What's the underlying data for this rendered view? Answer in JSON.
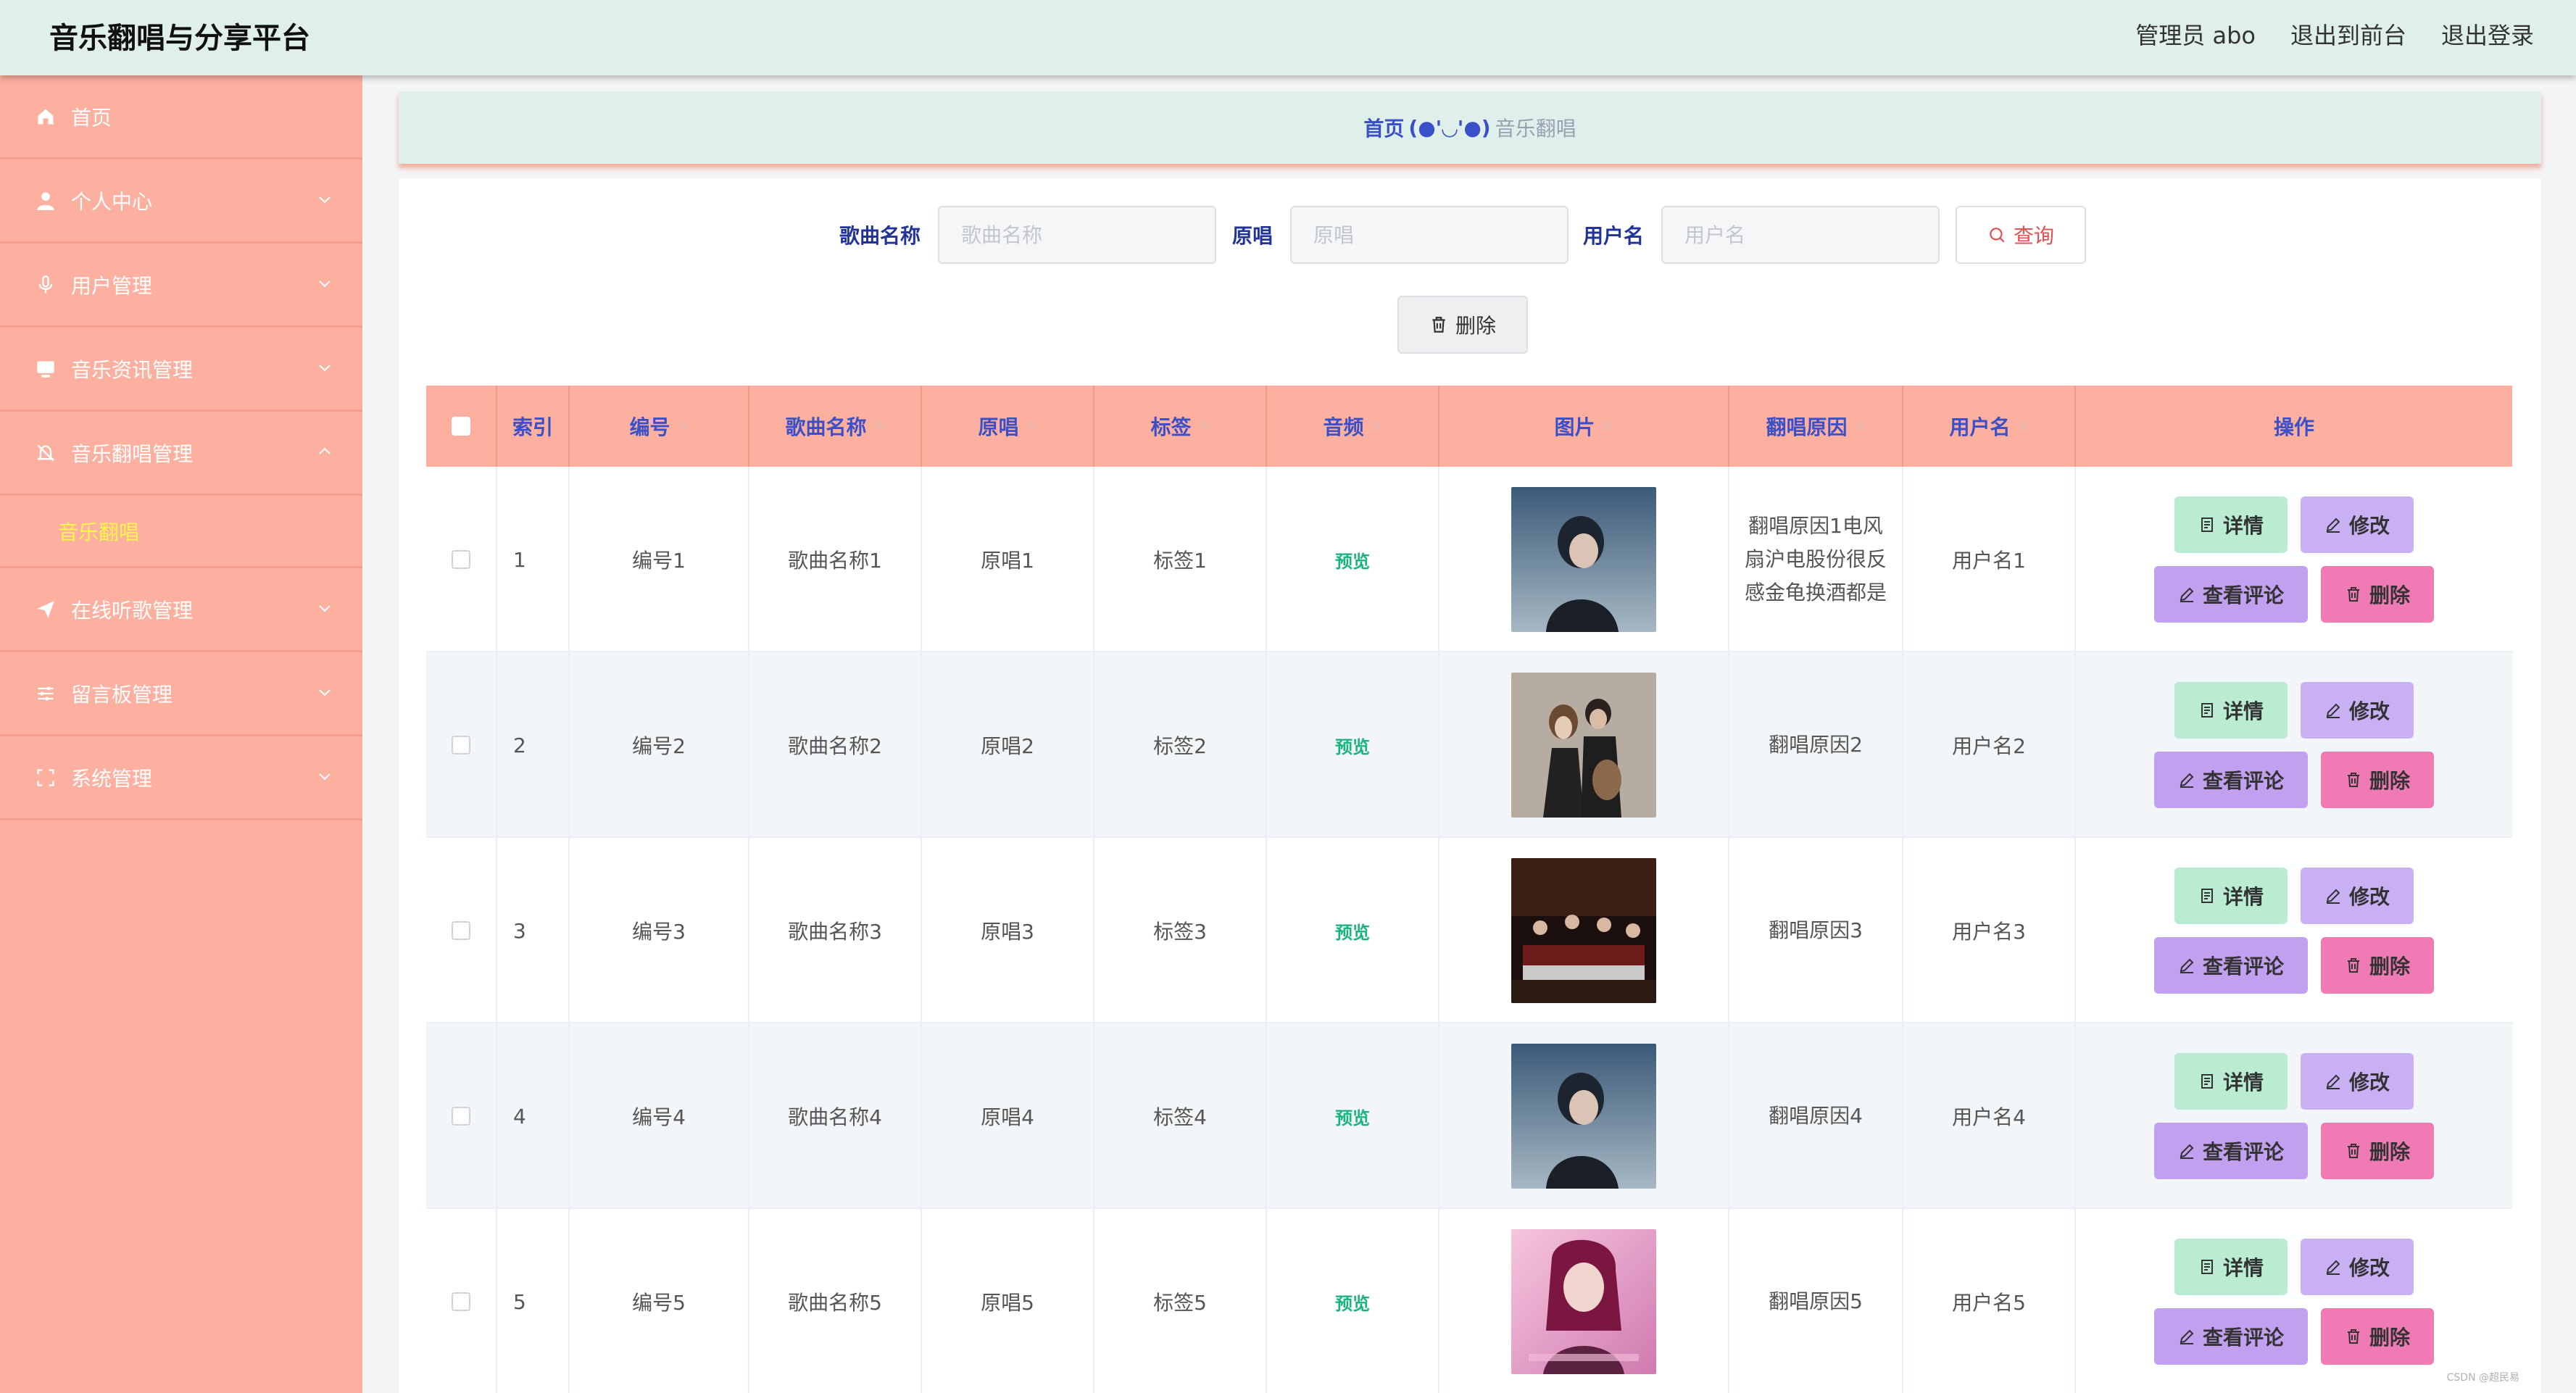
{
  "app": {
    "title": "音乐翻唱与分享平台",
    "top_links": [
      "管理员 abo",
      "退出到前台",
      "退出登录"
    ]
  },
  "sidebar": {
    "items": [
      {
        "label": "首页",
        "icon": "home-icon",
        "expandable": false
      },
      {
        "label": "个人中心",
        "icon": "user-icon",
        "expandable": true
      },
      {
        "label": "用户管理",
        "icon": "microphone-icon",
        "expandable": true
      },
      {
        "label": "音乐资讯管理",
        "icon": "monitor-icon",
        "expandable": true
      },
      {
        "label": "音乐翻唱管理",
        "icon": "bell-off-icon",
        "expandable": true,
        "expanded": true,
        "children": [
          "音乐翻唱"
        ]
      },
      {
        "label": "在线听歌管理",
        "icon": "send-icon",
        "expandable": true
      },
      {
        "label": "留言板管理",
        "icon": "sliders-icon",
        "expandable": true
      },
      {
        "label": "系统管理",
        "icon": "fullscreen-icon",
        "expandable": true
      }
    ]
  },
  "breadcrumb": {
    "home": "首页",
    "separator": "(●'◡'●)",
    "current": "音乐翻唱"
  },
  "search": {
    "fields": [
      {
        "label": "歌曲名称",
        "placeholder": "歌曲名称",
        "value": ""
      },
      {
        "label": "原唱",
        "placeholder": "原唱",
        "value": ""
      },
      {
        "label": "用户名",
        "placeholder": "用户名",
        "value": ""
      }
    ],
    "query_button": "查询",
    "delete_button": "删除"
  },
  "table": {
    "columns": [
      "索引",
      "编号",
      "歌曲名称",
      "原唱",
      "标签",
      "音频",
      "图片",
      "翻唱原因",
      "用户名",
      "操作"
    ],
    "rows": [
      {
        "index": "1",
        "code": "编号1",
        "song": "歌曲名称1",
        "original": "原唱1",
        "tag": "标签1",
        "audio": "预览",
        "reason": "翻唱原因1电风扇沪电股份很反感金龟换酒都是",
        "user": "用户名1",
        "image": "singer-photo"
      },
      {
        "index": "2",
        "code": "编号2",
        "song": "歌曲名称2",
        "original": "原唱2",
        "tag": "标签2",
        "audio": "预览",
        "reason": "翻唱原因2",
        "user": "用户名2",
        "image": "duet-photo"
      },
      {
        "index": "3",
        "code": "编号3",
        "song": "歌曲名称3",
        "original": "原唱3",
        "tag": "标签3",
        "audio": "预览",
        "reason": "翻唱原因3",
        "user": "用户名3",
        "image": "band-photo"
      },
      {
        "index": "4",
        "code": "编号4",
        "song": "歌曲名称4",
        "original": "原唱4",
        "tag": "标签4",
        "audio": "预览",
        "reason": "翻唱原因4",
        "user": "用户名4",
        "image": "singer-photo"
      },
      {
        "index": "5",
        "code": "编号5",
        "song": "歌曲名称5",
        "original": "原唱5",
        "tag": "标签5",
        "audio": "预览",
        "reason": "翻唱原因5",
        "user": "用户名5",
        "image": "album-cover-photo"
      }
    ],
    "actions": {
      "detail": "详情",
      "edit": "修改",
      "comments": "查看评论",
      "delete": "删除"
    }
  },
  "colors": {
    "sidebar": "#fdb09f",
    "topbar": "#dff0ea",
    "header_text": "#3a50c9",
    "submenu_active": "#fff64a",
    "preview_link": "#1db37f",
    "btn_detail": "#b9ecd2",
    "btn_edit": "#c8b0f2",
    "btn_comment": "#c1a0ef",
    "btn_delete": "#f07ab4"
  },
  "watermark": "CSDN @超民易"
}
